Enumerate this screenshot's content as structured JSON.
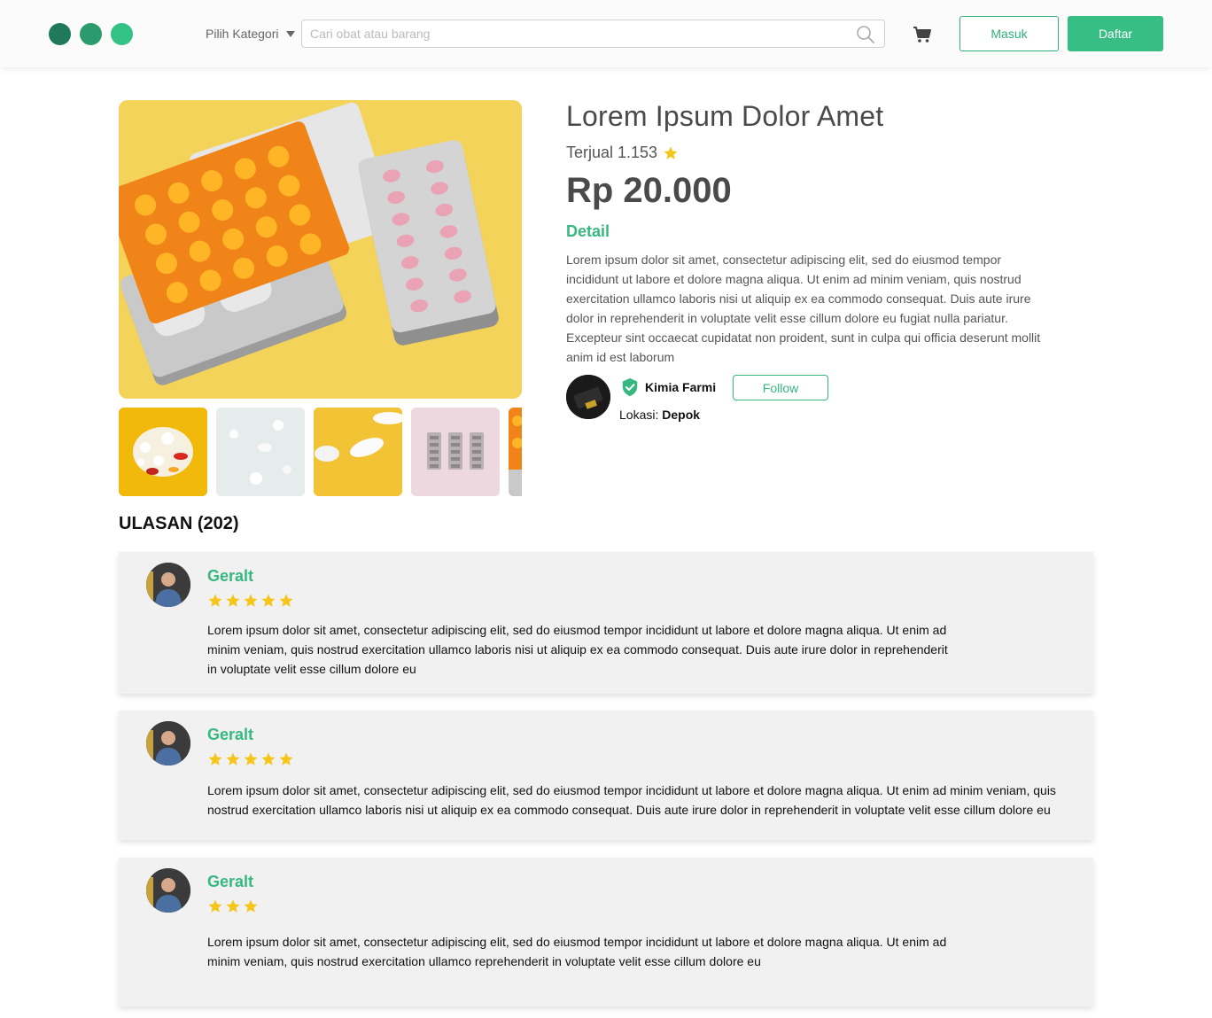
{
  "header": {
    "category_label": "Pilih Kategori",
    "search_placeholder": "Cari obat atau barang",
    "login_label": "Masuk",
    "register_label": "Daftar",
    "logo_colors": [
      "#20795a",
      "#2b9a6c",
      "#34c184"
    ]
  },
  "product": {
    "title": "Lorem Ipsum Dolor Amet",
    "sold_text": "Terjual 1.153",
    "price": "Rp 20.000",
    "detail_heading": "Detail",
    "description": "Lorem ipsum dolor sit amet, consectetur adipiscing elit, sed do eiusmod tempor incididunt ut labore et dolore magna aliqua. Ut enim ad minim veniam, quis nostrud exercitation ullamco laboris nisi ut aliquip ex ea commodo consequat. Duis aute irure dolor in reprehenderit in voluptate velit esse cillum dolore eu fugiat nulla pariatur. Excepteur sint occaecat cupidatat non proident, sunt in culpa qui officia deserunt mollit anim id est laborum",
    "thumbnails": [
      "assorted-pills",
      "white-pills",
      "white-tablets-yellow",
      "pink-blister-packs",
      "orange-blister-pack"
    ]
  },
  "seller": {
    "name": "Kimia Farmi",
    "follow_label": "Follow",
    "location_label": "Lokasi:",
    "location_value": "Depok"
  },
  "reviews": {
    "heading": "ULASAN (202)",
    "items": [
      {
        "name": "Geralt",
        "rating": 5,
        "text": "Lorem ipsum dolor sit amet, consectetur adipiscing elit, sed do eiusmod tempor incididunt ut labore et dolore magna aliqua. Ut enim ad minim veniam, quis nostrud exercitation ullamco laboris nisi ut aliquip ex ea commodo consequat. Duis aute irure dolor in reprehenderit in voluptate velit esse cillum dolore eu"
      },
      {
        "name": "Geralt",
        "rating": 5,
        "text": "Lorem ipsum dolor sit amet, consectetur adipiscing elit, sed do eiusmod tempor incididunt ut labore et dolore magna aliqua. Ut enim ad minim veniam, quis nostrud exercitation ullamco laboris nisi ut aliquip ex ea commodo consequat. Duis aute irure dolor in reprehenderit in voluptate velit esse cillum dolore eu"
      },
      {
        "name": "Geralt",
        "rating": 3,
        "text": "Lorem ipsum dolor sit amet, consectetur adipiscing elit, sed do eiusmod tempor incididunt ut labore et dolore magna aliqua. Ut enim ad minim veniam, quis nostrud exercitation ullamco reprehenderit in voluptate velit esse cillum dolore eu"
      }
    ]
  },
  "colors": {
    "accent": "#36be84",
    "star": "#f5c518",
    "text_dark": "#4a4a4a"
  }
}
